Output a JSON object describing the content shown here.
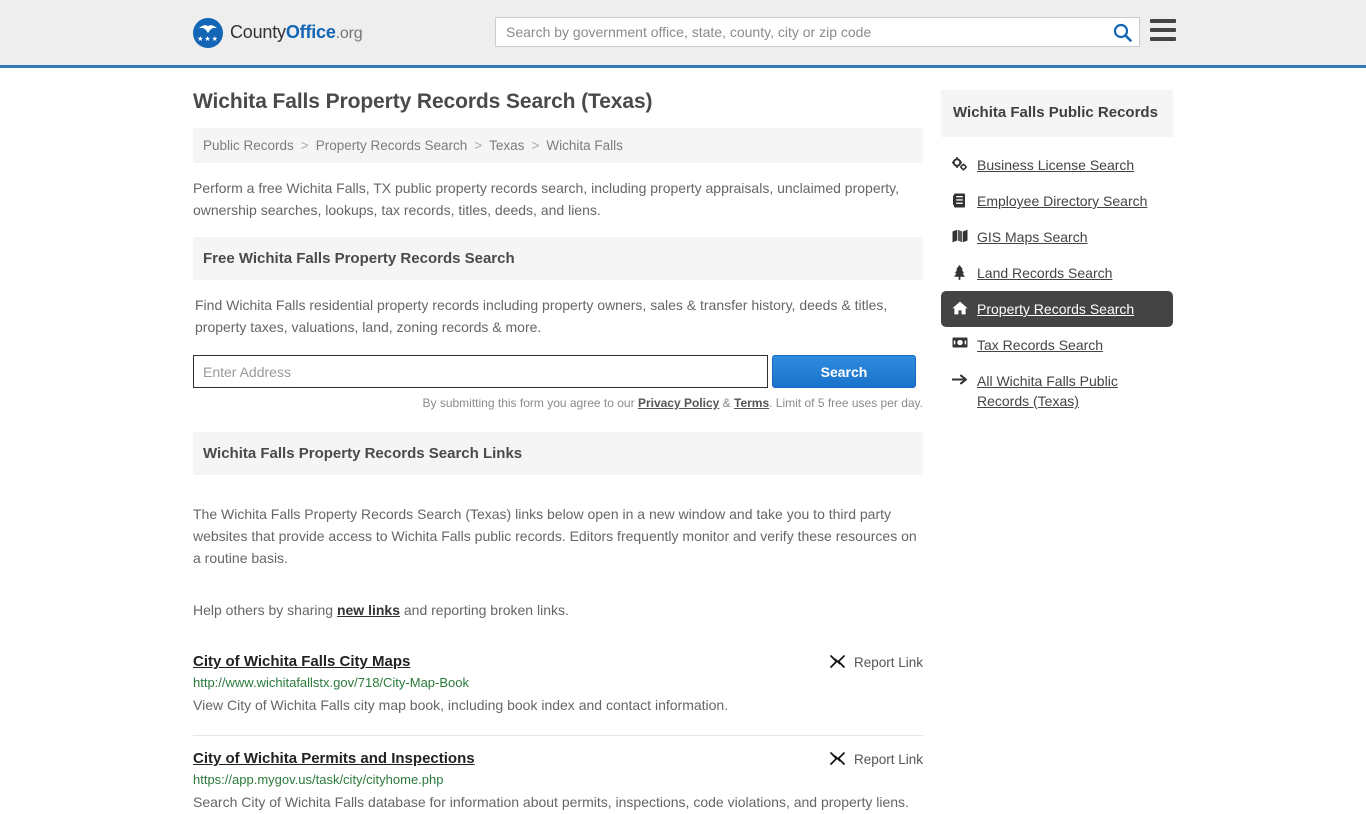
{
  "header": {
    "logo": {
      "text_part1": "County",
      "text_part2": "Office",
      "text_part3": ".org",
      "icon": "eagle-seal-icon"
    },
    "search": {
      "placeholder": "Search by government office, state, county, city or zip code",
      "value": "",
      "icon": "search-icon"
    },
    "menu_icon": "hamburger-menu-icon",
    "accent_color": "#337ab7"
  },
  "page_title": "Wichita Falls Property Records Search (Texas)",
  "breadcrumb": [
    "Public Records",
    "Property Records Search",
    "Texas",
    "Wichita Falls"
  ],
  "breadcrumb_separator": ">",
  "intro": "Perform a free Wichita Falls, TX public property records search, including property appraisals, unclaimed property, ownership searches, lookups, tax records, titles, deeds, and liens.",
  "free_search": {
    "heading": "Free Wichita Falls Property Records Search",
    "body": "Find Wichita Falls residential property records including property owners, sales & transfer history, deeds & titles, property taxes, valuations, land, zoning records & more.",
    "input_placeholder": "Enter Address",
    "input_value": "",
    "button_label": "Search",
    "button_color": "#1a73ca",
    "disclaimer_prefix": "By submitting this form you agree to our ",
    "disclaimer_privacy": "Privacy Policy",
    "disclaimer_amp": " & ",
    "disclaimer_terms": "Terms",
    "disclaimer_suffix": ". Limit of 5 free uses per day."
  },
  "links_section": {
    "heading": "Wichita Falls Property Records Search Links",
    "body": "The Wichita Falls Property Records Search (Texas) links below open in a new window and take you to third party websites that provide access to Wichita Falls public records. Editors frequently monitor and verify these resources on a routine basis.",
    "share_prefix": "Help others by sharing ",
    "share_link": "new links",
    "share_suffix": " and reporting broken links.",
    "report_label": "Report Link",
    "report_icon": "unlink-icon",
    "items": [
      {
        "title": "City of Wichita Falls City Maps",
        "url": "http://www.wichitafallstx.gov/718/City-Map-Book",
        "description": "View City of Wichita Falls city map book, including book index and contact information."
      },
      {
        "title": "City of Wichita Permits and Inspections",
        "url": "https://app.mygov.us/task/city/cityhome.php",
        "description": "Search City of Wichita Falls database for information about permits, inspections, code violations, and property liens."
      }
    ]
  },
  "sidebar": {
    "heading": "Wichita Falls Public Records",
    "active_color": "#444444",
    "items": [
      {
        "label": "Business License Search",
        "icon": "cogs-icon",
        "active": false
      },
      {
        "label": "Employee Directory Search",
        "icon": "address-book-icon",
        "active": false
      },
      {
        "label": "GIS Maps Search",
        "icon": "map-icon",
        "active": false
      },
      {
        "label": "Land Records Search",
        "icon": "tree-icon",
        "active": false
      },
      {
        "label": "Property Records Search",
        "icon": "home-icon",
        "active": true
      },
      {
        "label": "Tax Records Search",
        "icon": "money-bill-icon",
        "active": false
      },
      {
        "label": "All Wichita Falls Public Records (Texas)",
        "icon": "arrow-right-icon",
        "active": false
      }
    ]
  }
}
